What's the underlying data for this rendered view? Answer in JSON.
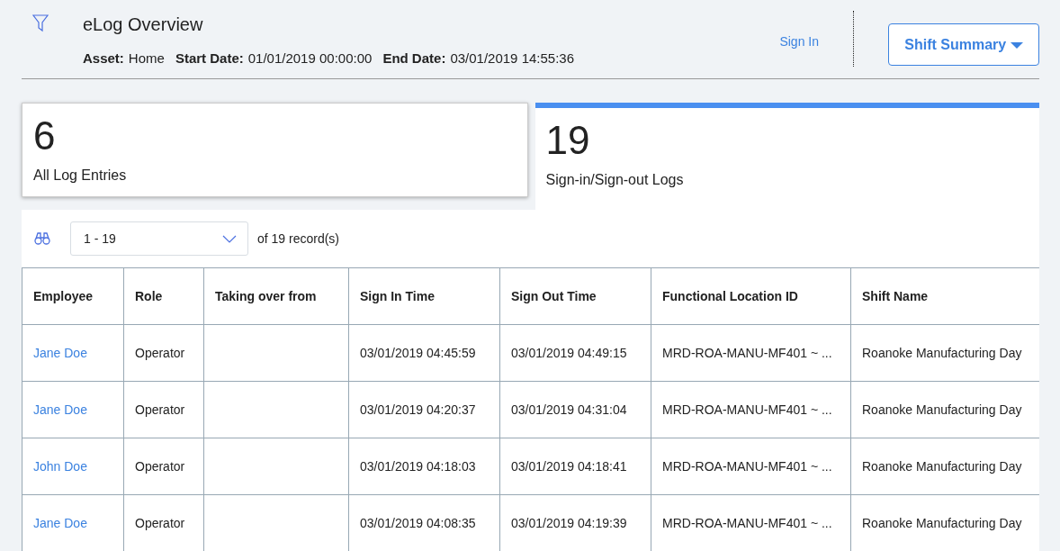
{
  "header": {
    "title": "eLog Overview",
    "fields": [
      {
        "label": "Asset:",
        "value": "Home"
      },
      {
        "label": "Start Date:",
        "value": "01/01/2019 00:00:00"
      },
      {
        "label": "End Date:",
        "value": "03/01/2019 14:55:36"
      }
    ],
    "sign_in": "Sign In",
    "shift_summary": "Shift Summary"
  },
  "tiles": [
    {
      "count": "6",
      "label": "All Log Entries",
      "selected": false
    },
    {
      "count": "19",
      "label": "Sign-in/Sign-out Logs",
      "selected": true
    }
  ],
  "pager": {
    "range": "1 - 19",
    "of": "of",
    "total": "19",
    "unit": "record(s)"
  },
  "table": {
    "columns": [
      "Employee",
      "Role",
      "Taking over from",
      "Sign In Time",
      "Sign Out Time",
      "Functional Location ID",
      "Shift Name"
    ],
    "rows": [
      [
        "Jane Doe",
        "Operator",
        "",
        "03/01/2019 04:45:59",
        "03/01/2019 04:49:15",
        "MRD-ROA-MANU-MF401 ~ ...",
        "Roanoke Manufacturing Day"
      ],
      [
        "Jane Doe",
        "Operator",
        "",
        "03/01/2019 04:20:37",
        "03/01/2019 04:31:04",
        "MRD-ROA-MANU-MF401 ~ ...",
        "Roanoke Manufacturing Day"
      ],
      [
        "John Doe",
        "Operator",
        "",
        "03/01/2019 04:18:03",
        "03/01/2019 04:18:41",
        "MRD-ROA-MANU-MF401 ~ ...",
        "Roanoke Manufacturing Day"
      ],
      [
        "Jane Doe",
        "Operator",
        "",
        "03/01/2019 04:08:35",
        "03/01/2019 04:19:39",
        "MRD-ROA-MANU-MF401 ~ ...",
        "Roanoke Manufacturing Day"
      ]
    ]
  }
}
